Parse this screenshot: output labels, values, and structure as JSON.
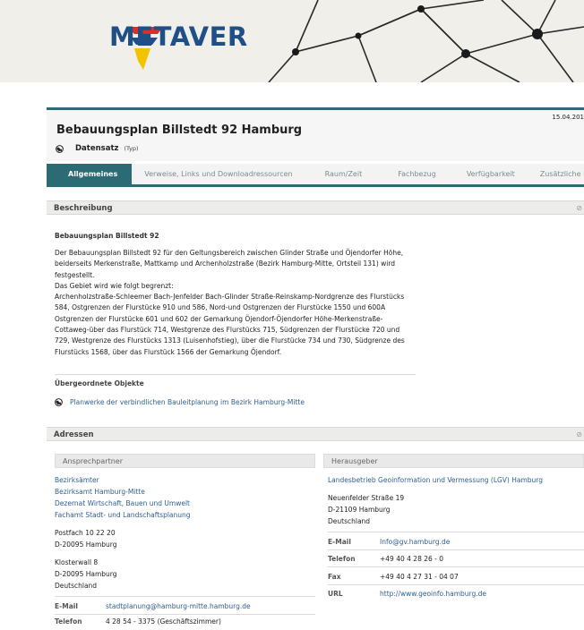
{
  "header": {
    "logo_text": "METAVER"
  },
  "document": {
    "title": "Bebauungsplan Billstedt 92 Hamburg",
    "date": "15.04.201",
    "type_label": "Datensatz",
    "type_hint": "(Typ)"
  },
  "tabs": [
    {
      "label": "Allgemeines"
    },
    {
      "label": "Verweise, Links und Downloadressourcen"
    },
    {
      "label": "Raum/Zeit"
    },
    {
      "label": "Fachbezug"
    },
    {
      "label": "Verfügbarkeit"
    },
    {
      "label": "Zusätzliche I"
    }
  ],
  "description": {
    "section_label": "Beschreibung",
    "subtitle": "Bebauungsplan Billstedt 92",
    "lines": [
      "Der Bebauungsplan Billstedt 92 für den Geltungsbereich zwischen Glinder Straße und Öjendorfer Höhe,",
      "beiderseits Merkenstraße, Mattkamp und Archenholzstraße (Bezirk Hamburg-Mitte, Ortsteil 131) wird",
      "festgestellt.",
      "Das Gebiet wird wie folgt begrenzt:",
      "Archenholzstraße-Schleemer Bach-Jenfelder Bach-Glinder Straße-Reinskamp-Nordgrenze des Flurstücks",
      "584, Ostgrenzen der Flurstücke 910 und 586, Nord-und Ostgrenzen der Flurstücke 1550 und 600A",
      "Ostgrenzen der Flurstücke 601 und 602 der Gemarkung Öjendorf-Öjendorfer Höhe-Merkenstraße-",
      "Cottaweg-über das Flurstück 714, Westgrenze des Flurstücks 715, Südgrenzen der Flurstücke 720 und",
      "729, Westgrenze des Flurstücks 1313 (Luisenhofstieg), über die Flurstücke 734 und 730, Südgrenze des",
      "Flurstücks 1568, über das Flurstück 1566 der Gemarkung Öjendorf."
    ],
    "superior_label": "Übergeordnete Objekte",
    "superior_link": "Planwerke der verbindlichen Bauleitplanung im Bezirk Hamburg-Mitte"
  },
  "addresses": {
    "section_label": "Adressen",
    "contact": {
      "header": "Ansprechpartner",
      "org_lines": [
        "Bezirksämter",
        "Bezirksamt Hamburg-Mitte",
        "Dezernat Wirtschaft, Bauen und Umwelt",
        "Fachamt Stadt- und Landschaftsplanung"
      ],
      "postbox": [
        "Postfach 10 22 20",
        "D-20095 Hamburg"
      ],
      "street": [
        "Klosterwall 8",
        "D-20095 Hamburg",
        "Deutschland"
      ],
      "email_label": "E-Mail",
      "email": "stadtplanung@hamburg-mitte.hamburg.de",
      "phone_label": "Telefon",
      "phone": "4 28 54 - 3375 (Geschäftszimmer)"
    },
    "publisher": {
      "header": "Herausgeber",
      "org": "Landesbetrieb Geoinformation und Vermessung (LGV) Hamburg",
      "street": [
        "Neuenfelder Straße 19",
        "D-21109 Hamburg",
        "Deutschland"
      ],
      "email_label": "E-Mail",
      "email": "Info@gv.hamburg.de",
      "phone_label": "Telefon",
      "phone": "+49 40 4 28 26 - 0",
      "fax_label": "Fax",
      "fax": "+49 40 4 27 31 - 04 07",
      "url_label": "URL",
      "url": "http://www.geoinfo.hamburg.de"
    }
  },
  "colors": {
    "accent": "#2c6b74",
    "link": "#2f5f8f",
    "logo_blue": "#1f4f86",
    "logo_red": "#d6312b",
    "logo_yellow": "#f2c300"
  }
}
